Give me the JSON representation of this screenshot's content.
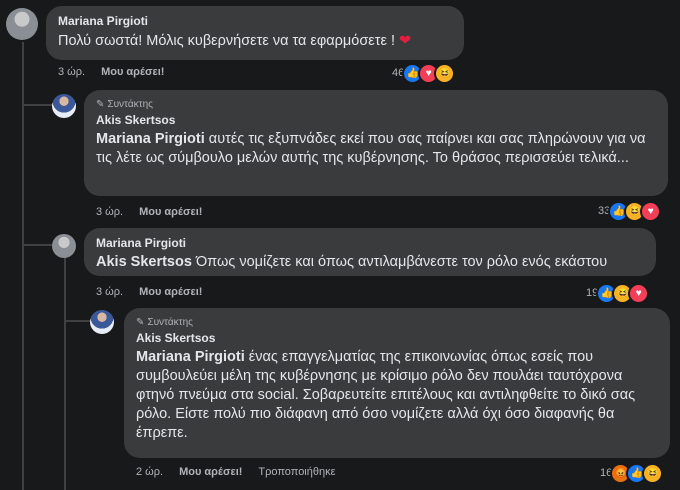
{
  "comments": [
    {
      "author": "Mariana Pirgioti",
      "text": "Πολύ σωστά! Μόλις κυβερνήσετε να τα εφαρμόσετε ! ",
      "emoji": "❤",
      "time": "3 ώρ.",
      "like": "Μου αρέσει!",
      "reaction_count": "46",
      "reactions": [
        "like-icon",
        "love-icon",
        "haha-icon"
      ]
    },
    {
      "badge": "Συντάκτης",
      "author": "Akis Skertsos",
      "mention": "Mariana Pirgioti",
      "text": " αυτές τις εξυπνάδες εκεί που σας παίρνει και σας πληρώνουν για να τις λέτε ως σύμβουλο μελών αυτής της κυβέρνησης. Το θράσος περισσεύει τελικά...",
      "time": "3 ώρ.",
      "like": "Μου αρέσει!",
      "reaction_count": "33",
      "reactions": [
        "like-icon",
        "haha-icon",
        "love-icon"
      ]
    },
    {
      "author": "Mariana Pirgioti",
      "mention": "Akis Skertsos",
      "text": " Όπως νομίζετε και όπως αντιλαμβάνεστε τον ρόλο ενός εκάστου",
      "time": "3 ώρ.",
      "like": "Μου αρέσει!",
      "reaction_count": "19",
      "reactions": [
        "like-icon",
        "haha-icon",
        "love-icon"
      ]
    },
    {
      "badge": "Συντάκτης",
      "author": "Akis Skertsos",
      "mention": "Mariana Pirgioti",
      "text": " ένας επαγγελματίας της επικοινωνίας όπως εσείς που συμβουλεύει μέλη της κυβέρνησης με κρίσιμο ρόλο δεν πουλάει ταυτόχρονα φτηνό πνεύμα στα social. Σοβαρευτείτε επιτέλους και αντιληφθείτε το δικό σας ρόλο. Είστε πολύ πιο διάφανη από όσο νομίζετε αλλά όχι όσο διαφανής θα έπρεπε.",
      "time": "2 ώρ.",
      "like": "Μου αρέσει!",
      "edited": "Τροποποιήθηκε",
      "reaction_count": "16",
      "reactions": [
        "angry-icon",
        "like-icon",
        "haha-icon"
      ]
    }
  ],
  "colors": {
    "background": "#18191a",
    "bubble": "#3a3b3c",
    "like": "#1877f2",
    "love": "#f33e58",
    "haha": "#f7b125",
    "angry": "#e9710f"
  }
}
